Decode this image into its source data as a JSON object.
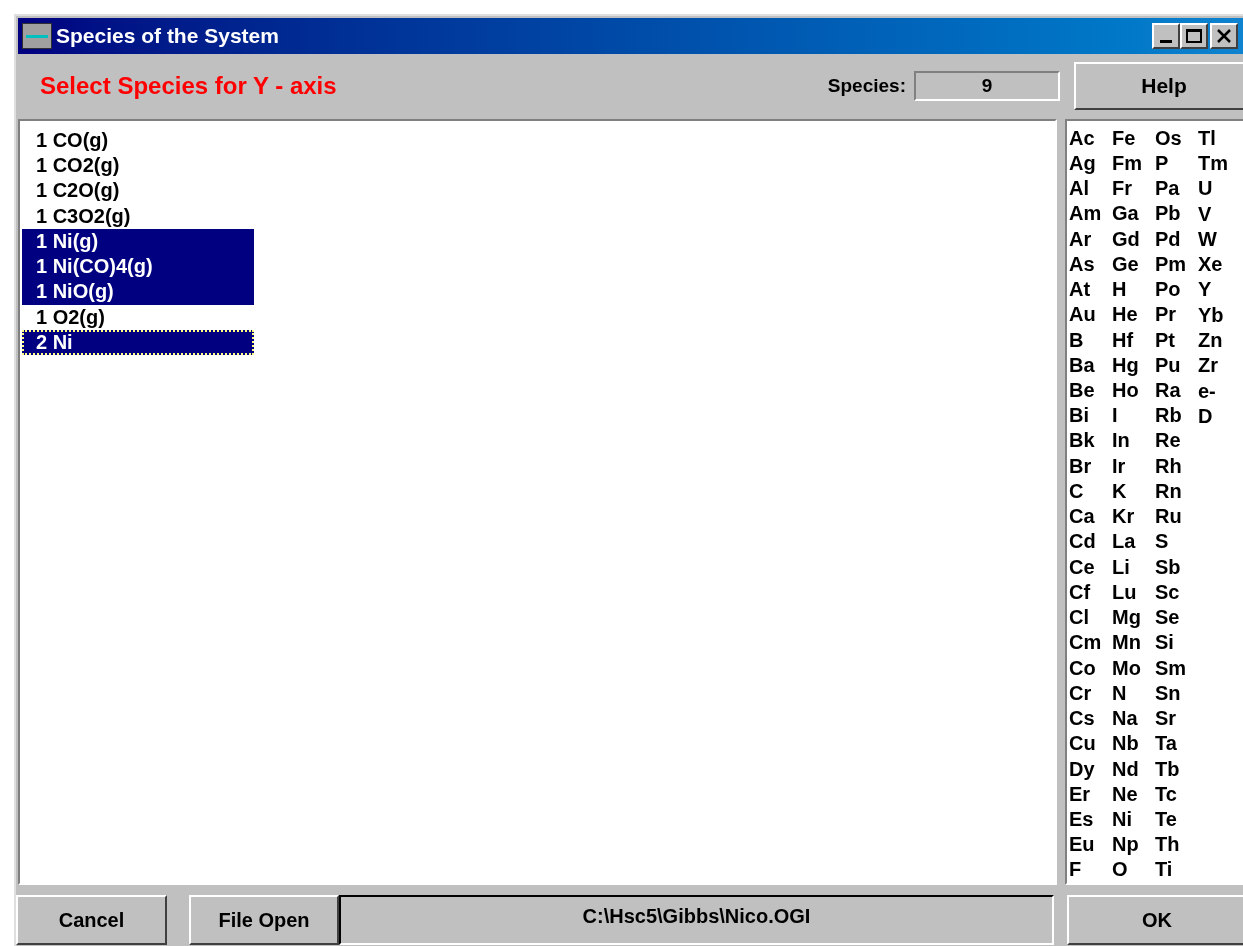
{
  "window": {
    "title": "Species of the System"
  },
  "heading": "Select Species for Y - axis",
  "species_count": {
    "label": "Species:",
    "value": "9"
  },
  "help_button": "Help",
  "species_list": [
    {
      "label": "1 CO(g)",
      "selected": false,
      "focused": false
    },
    {
      "label": "1 CO2(g)",
      "selected": false,
      "focused": false
    },
    {
      "label": "1 C2O(g)",
      "selected": false,
      "focused": false
    },
    {
      "label": "1 C3O2(g)",
      "selected": false,
      "focused": false
    },
    {
      "label": "1 Ni(g)",
      "selected": true,
      "focused": false
    },
    {
      "label": "1 Ni(CO)4(g)",
      "selected": true,
      "focused": false
    },
    {
      "label": "1 NiO(g)",
      "selected": true,
      "focused": false
    },
    {
      "label": "1 O2(g)",
      "selected": false,
      "focused": false
    },
    {
      "label": "2 Ni",
      "selected": true,
      "focused": true
    }
  ],
  "element_columns": [
    [
      "Ac",
      "Ag",
      "Al",
      "Am",
      "Ar",
      "As",
      "At",
      "Au",
      "B",
      "Ba",
      "Be",
      "Bi",
      "Bk",
      "Br",
      "C",
      "Ca",
      "Cd",
      "Ce",
      "Cf",
      "Cl",
      "Cm",
      "Co",
      "Cr",
      "Cs",
      "Cu",
      "Dy",
      "Er",
      "Es",
      "Eu",
      "F"
    ],
    [
      "Fe",
      "Fm",
      "Fr",
      "Ga",
      "Gd",
      "Ge",
      "H",
      "He",
      "Hf",
      "Hg",
      "Ho",
      "I",
      "In",
      "Ir",
      "K",
      "Kr",
      "La",
      "Li",
      "Lu",
      "Mg",
      "Mn",
      "Mo",
      "N",
      "Na",
      "Nb",
      "Nd",
      "Ne",
      "Ni",
      "Np",
      "O"
    ],
    [
      "Os",
      "P",
      "Pa",
      "Pb",
      "Pd",
      "Pm",
      "Po",
      "Pr",
      "Pt",
      "Pu",
      "Ra",
      "Rb",
      "Re",
      "Rh",
      "Rn",
      "Ru",
      "S",
      "Sb",
      "Sc",
      "Se",
      "Si",
      "Sm",
      "Sn",
      "Sr",
      "Ta",
      "Tb",
      "Tc",
      "Te",
      "Th",
      "Ti"
    ],
    [
      "Tl",
      "Tm",
      "U",
      "V",
      "W",
      "Xe",
      "Y",
      "Yb",
      "Zn",
      "Zr",
      "e-",
      "D"
    ]
  ],
  "buttons": {
    "cancel": "Cancel",
    "file_open": "File Open",
    "ok": "OK"
  },
  "file_path": "C:\\Hsc5\\Gibbs\\Nico.OGI"
}
